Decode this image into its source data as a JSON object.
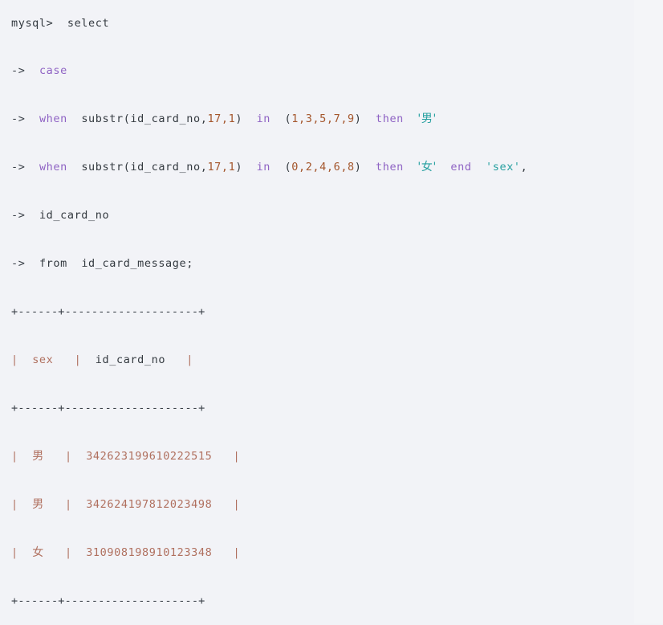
{
  "terminal": {
    "prompt": "mysql>",
    "continuation": "->",
    "background_color": "#f2f3f7",
    "keyword_color": "#8f63c4",
    "number_color": "#a4562c",
    "string_color": "#27a0a0",
    "plain_color": "#343a40",
    "result_color": "#b0705f"
  },
  "query": {
    "line1": {
      "prompt": "mysql>",
      "command": "select"
    },
    "line2": {
      "arrow": "->",
      "keyword": "case"
    },
    "line3": {
      "arrow": "->",
      "when": "when",
      "func": "substr(id_card_no,",
      "args": "17,1",
      "close": ")",
      "in": "in",
      "open_list": "(",
      "list": "1,3,5,7,9",
      "close_list": ")",
      "then": "then",
      "value": "'男'"
    },
    "line4": {
      "arrow": "->",
      "when": "when",
      "func": "substr(id_card_no,",
      "args": "17,1",
      "close": ")",
      "in": "in",
      "open_list": "(",
      "list": "0,2,4,6,8",
      "close_list": ")",
      "then": "then",
      "value": "'女'",
      "end": "end",
      "alias": "'sex'",
      "comma": ","
    },
    "line5": {
      "arrow": "->",
      "column": "id_card_no"
    },
    "line6": {
      "arrow": "->",
      "from": "from",
      "table": "id_card_message;"
    }
  },
  "result_table": {
    "border_top": "+------+--------------------+",
    "border_mid": "+------+--------------------+",
    "border_bottom": "+------+--------------------+",
    "pipe": "|",
    "headers": [
      "sex",
      "id_card_no"
    ],
    "rows": [
      {
        "sex": "男",
        "id_card_no": "342623199610222515"
      },
      {
        "sex": "男",
        "id_card_no": "342624197812023498"
      },
      {
        "sex": "女",
        "id_card_no": "310908198910123348"
      }
    ]
  }
}
